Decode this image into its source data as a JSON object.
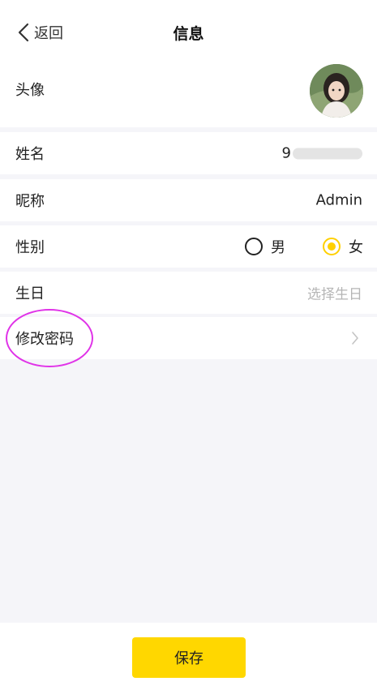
{
  "header": {
    "back_label": "返回",
    "title": "信息"
  },
  "profile": {
    "avatar": {
      "label": "头像"
    },
    "name": {
      "label": "姓名",
      "value_visible": "9"
    },
    "nickname": {
      "label": "昵称",
      "value": "Admin"
    },
    "gender": {
      "label": "性别",
      "options": [
        {
          "label": "男",
          "selected": false
        },
        {
          "label": "女",
          "selected": true
        }
      ]
    },
    "birthday": {
      "label": "生日",
      "placeholder": "选择生日"
    },
    "password": {
      "label": "修改密码"
    }
  },
  "footer": {
    "save_label": "保存"
  },
  "colors": {
    "accent": "#ffd700",
    "background": "#f5f5f9",
    "annotation": "#e033e8"
  },
  "icons": {
    "back": "chevron-left-icon",
    "password_arrow": "chevron-right-icon",
    "radio_unselected": "radio-empty-icon",
    "radio_selected": "radio-checked-icon"
  }
}
